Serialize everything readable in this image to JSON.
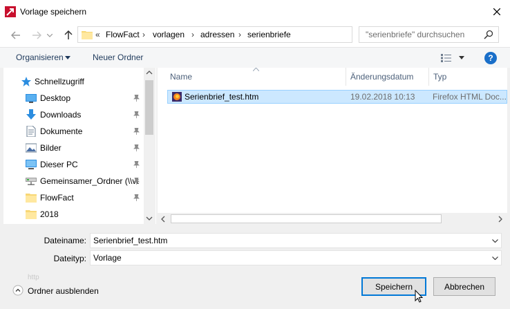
{
  "window": {
    "title": "Vorlage speichern"
  },
  "nav": {
    "breadcrumb_prefix": "«",
    "crumbs": [
      "FlowFact",
      "vorlagen",
      "adressen",
      "serienbriefe"
    ],
    "search_placeholder": "\"serienbriefe\" durchsuchen"
  },
  "toolbar": {
    "organise_label": "Organisieren",
    "new_folder_label": "Neuer Ordner",
    "help_label": "?"
  },
  "sidebar": {
    "items": [
      {
        "label": "Schnellzugriff",
        "icon": "star-icon"
      },
      {
        "label": "Desktop",
        "icon": "desktop-icon",
        "pinned": true
      },
      {
        "label": "Downloads",
        "icon": "download-icon",
        "pinned": true
      },
      {
        "label": "Dokumente",
        "icon": "documents-icon",
        "pinned": true
      },
      {
        "label": "Bilder",
        "icon": "pictures-icon",
        "pinned": true
      },
      {
        "label": "Dieser PC",
        "icon": "computer-icon",
        "pinned": true
      },
      {
        "label": "Gemeinsamer_Ordner (\\\\vt",
        "icon": "network-drive-icon",
        "pinned": true
      },
      {
        "label": "FlowFact",
        "icon": "folder-icon",
        "pinned": true
      },
      {
        "label": "2018",
        "icon": "folder-icon"
      }
    ]
  },
  "files": {
    "columns": [
      "Name",
      "Änderungsdatum",
      "Typ"
    ],
    "rows": [
      {
        "name": "Serienbrief_test.htm",
        "date": "19.02.2018 10:13",
        "type": "Firefox HTML Doc..."
      }
    ]
  },
  "form": {
    "filename_label": "Dateiname:",
    "filename_value": "Serienbrief_test.htm",
    "filetype_label": "Dateityp:",
    "filetype_value": "Vorlage",
    "hint_text": "http"
  },
  "footer": {
    "hide_folders_label": "Ordner ausblenden",
    "save_label": "Speichern",
    "cancel_label": "Abbrechen"
  },
  "colors": {
    "accent": "#0078d7",
    "selection": "#cce8ff",
    "link_text": "#1e395b"
  }
}
